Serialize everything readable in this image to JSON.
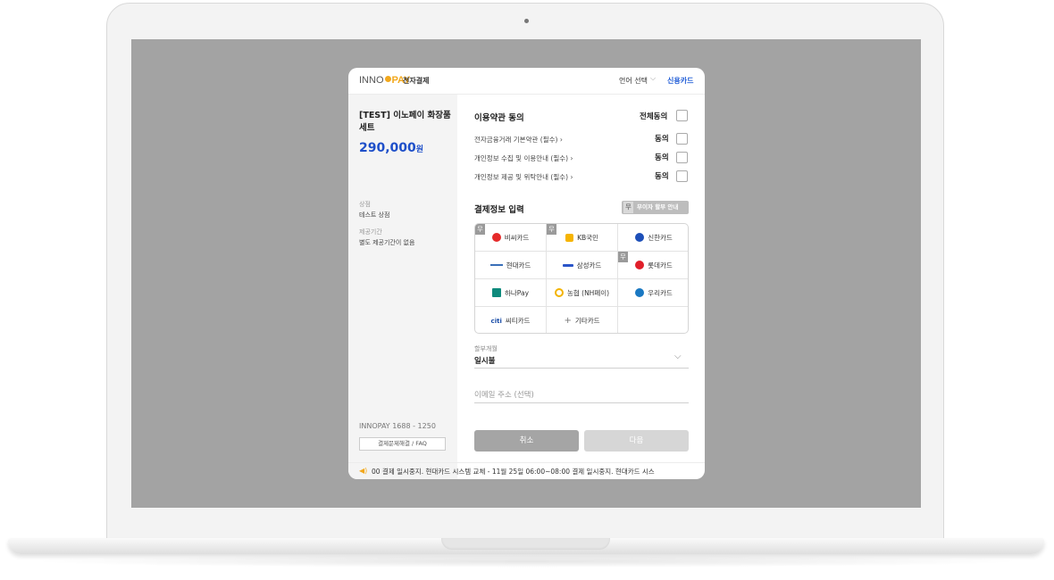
{
  "header": {
    "logo_inno": "INNO",
    "logo_pay": "PAY",
    "logo_sub": "전자결제",
    "language_label": "언어 선택",
    "method_label": "신용카드"
  },
  "product": {
    "name": "[TEST] 이노페이 화장품 세트",
    "price": "290,000",
    "currency": "원",
    "store_label": "상점",
    "store_value": "테스트 상점",
    "period_label": "제공기간",
    "period_value": "별도 제공기간이 없음",
    "phone": "INNOPAY 1688 - 1250",
    "faq_button": "결제문제해결 / FAQ"
  },
  "terms": {
    "title": "이용약관 동의",
    "agree_all": "전체동의",
    "items": [
      {
        "label": "전자금융거래 기본약관 (필수)",
        "agree": "동의"
      },
      {
        "label": "개인정보 수집 및 이용안내 (필수)",
        "agree": "동의"
      },
      {
        "label": "개인정보 제공 및 위탁안내 (필수)",
        "agree": "동의"
      }
    ]
  },
  "payment": {
    "title": "결제정보 입력",
    "no_interest_badge": "무",
    "no_interest_button": "무이자 할부 안내",
    "cards": [
      {
        "label": "비씨카드",
        "badge": "무",
        "color": "#e52a2a"
      },
      {
        "label": "KB국민",
        "badge": "무",
        "color": "#f6b400"
      },
      {
        "label": "신한카드",
        "badge": "",
        "color": "#1d4fb8"
      },
      {
        "label": "현대카드",
        "badge": "",
        "color": "#3a6fb8"
      },
      {
        "label": "삼성카드",
        "badge": "",
        "color": "#2a55c8"
      },
      {
        "label": "롯데카드",
        "badge": "무",
        "color": "#e01f2a"
      },
      {
        "label": "하나Pay",
        "badge": "",
        "color": "#0e8a7c"
      },
      {
        "label": "농협 (NH페이)",
        "badge": "",
        "color": "#f3b300"
      },
      {
        "label": "우리카드",
        "badge": "",
        "color": "#1a78c2"
      },
      {
        "label": "씨티카드",
        "badge": "",
        "color": "#1b4ea8"
      },
      {
        "label": "기타카드",
        "badge": "",
        "color": "#777777"
      }
    ],
    "installment_label": "할부개월",
    "installment_value": "일시불",
    "email_placeholder": "이메일 주소 (선택)"
  },
  "actions": {
    "cancel": "취소",
    "next": "다음"
  },
  "ticker": {
    "text": "00 결제 일시중지.    현대카드 시스템 교체 - 11월 25일 06:00~08:00 결제 일시중지.    현대카드 시스"
  }
}
